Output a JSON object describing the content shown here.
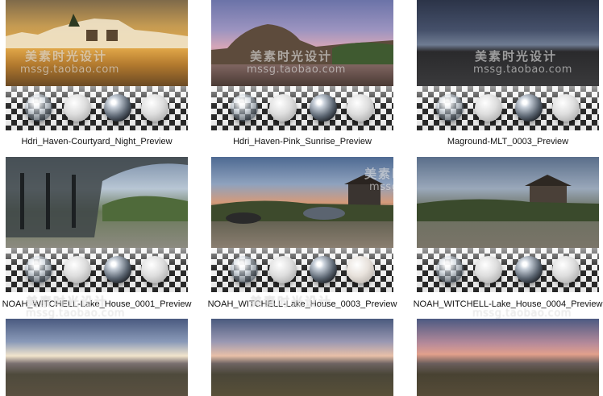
{
  "watermark": {
    "cn": "美素时光设计",
    "url": "mssg.taobao.com"
  },
  "tiles": [
    {
      "caption": "Hdri_Haven-Courtyard_Night_Preview"
    },
    {
      "caption": "Hdri_Haven-Pink_Sunrise_Preview"
    },
    {
      "caption": "Maground-MLT_0003_Preview"
    },
    {
      "caption": "NOAH_WITCHELL-Lake_House_0001_Preview"
    },
    {
      "caption": "NOAH_WITCHELL-Lake_House_0003_Preview"
    },
    {
      "caption": "NOAH_WITCHELL-Lake_House_0004_Preview"
    },
    {
      "caption": ""
    },
    {
      "caption": ""
    },
    {
      "caption": ""
    }
  ]
}
